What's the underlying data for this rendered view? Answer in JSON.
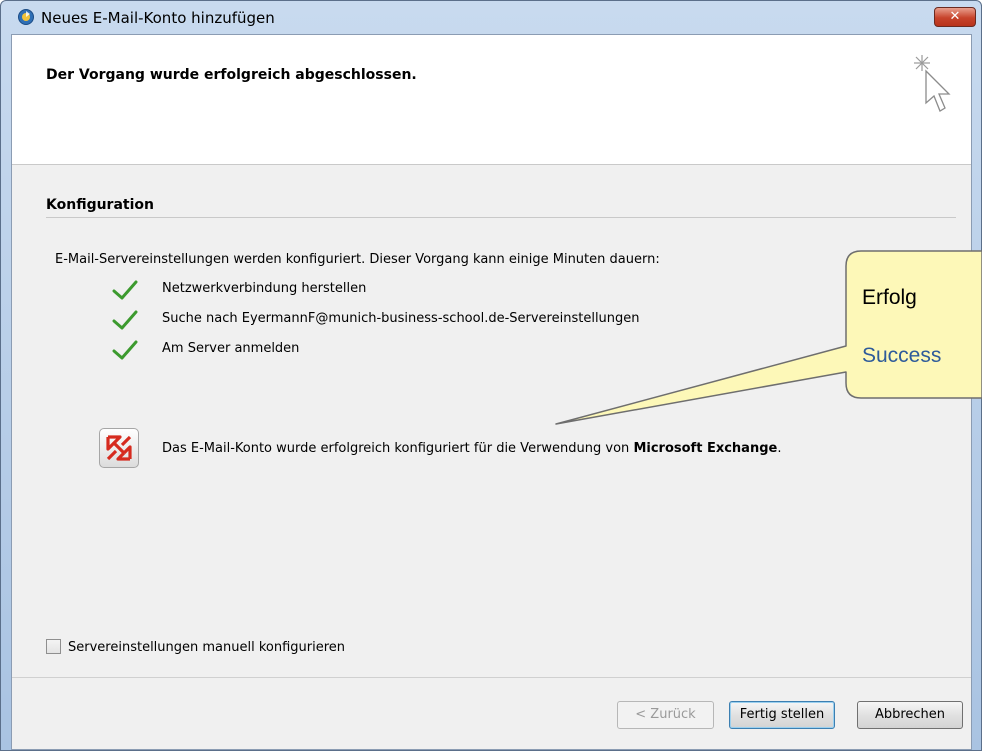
{
  "window": {
    "title": "Neues E-Mail-Konto hinzufügen",
    "close_label": "✕"
  },
  "header": {
    "title": "Der Vorgang wurde erfolgreich abgeschlossen."
  },
  "section": {
    "title": "Konfiguration",
    "intro": "E-Mail-Servereinstellungen werden konfiguriert. Dieser Vorgang kann einige Minuten dauern:"
  },
  "steps": [
    {
      "label": "Netzwerkverbindung herstellen",
      "status": "done"
    },
    {
      "label": "Suche nach EyermannF@munich-business-school.de-Servereinstellungen",
      "status": "done"
    },
    {
      "label": "Am Server anmelden",
      "status": "done"
    }
  ],
  "result": {
    "text": "Das E-Mail-Konto wurde erfolgreich konfiguriert für die Verwendung von",
    "product": "Microsoft Exchange",
    "suffix": "."
  },
  "manual_config": {
    "label": "Servereinstellungen manuell konfigurieren",
    "checked": false
  },
  "buttons": {
    "back": "< Zurück",
    "finish": "Fertig stellen",
    "cancel": "Abbrechen"
  },
  "callout": {
    "line1": "Erfolg",
    "line2": "Success"
  },
  "colors": {
    "check_green": "#3c9a2e",
    "callout_fill": "#fdf8b8",
    "callout_stroke": "#6e6e6e",
    "exchange_red": "#d62b1f"
  }
}
